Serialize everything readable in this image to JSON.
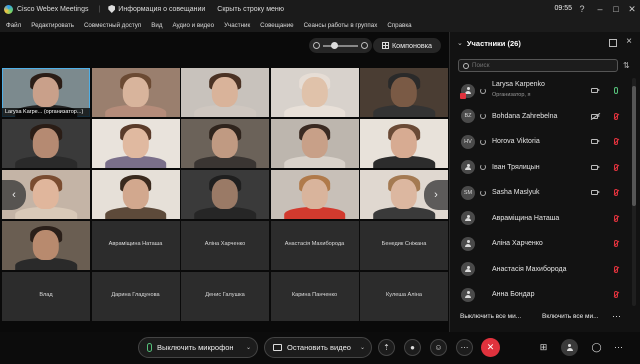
{
  "window": {
    "app_title": "Cisco Webex Meetings",
    "info_button": "Информация о совещании",
    "hide_menu_button": "Скрыть строку меню",
    "clock": "09:55"
  },
  "menu": [
    "Файл",
    "Редактировать",
    "Совместный доступ",
    "Вид",
    "Аудио и видео",
    "Участник",
    "Совещание",
    "Сеансы работы в группах",
    "Справка"
  ],
  "stage": {
    "layout_button": "Компоновка",
    "tiles": [
      {
        "type": "video",
        "label": "Larysa Karpe... (организатор...)",
        "skin": "#c9a08a",
        "hair": "#2b1d16",
        "shirt": "#222222",
        "bg": "#7c8a8e",
        "active": true
      },
      {
        "type": "video",
        "label": "",
        "skin": "#d8b49c",
        "hair": "#6b4a33",
        "shirt": "#b58c7a",
        "bg": "#9a7f6e"
      },
      {
        "type": "video",
        "label": "",
        "skin": "#d9b39a",
        "hair": "#4a3224",
        "shirt": "#cfc7c0",
        "bg": "#c8c2bc"
      },
      {
        "type": "video",
        "label": "",
        "skin": "#e0c2aa",
        "hair": "#e6ddd5",
        "shirt": "#e8e0d8",
        "bg": "#d8d2cc"
      },
      {
        "type": "video",
        "label": "",
        "skin": "#7a5a45",
        "hair": "#2a2a2a",
        "shirt": "#333333",
        "bg": "#4a3d33"
      },
      {
        "type": "video",
        "label": "",
        "skin": "#b58a72",
        "hair": "#2a1d16",
        "shirt": "#2a2a2a",
        "bg": "#3a3a3a"
      },
      {
        "type": "video",
        "label": "",
        "skin": "#e0b9a0",
        "hair": "#5a3b2a",
        "shirt": "#7a6f8a",
        "bg": "#e9e3dc"
      },
      {
        "type": "video",
        "label": "",
        "skin": "#c09a82",
        "hair": "#2f241d",
        "shirt": "#3a3532",
        "bg": "#6b6259"
      },
      {
        "type": "video",
        "label": "",
        "skin": "#c8a088",
        "hair": "#3a2a22",
        "shirt": "#d9d2ca",
        "bg": "#bdb6ae"
      },
      {
        "type": "video",
        "label": "",
        "skin": "#d7ab92",
        "hair": "#6a4a36",
        "shirt": "#2c2c2c",
        "bg": "#e8e2da"
      },
      {
        "type": "video",
        "label": "",
        "skin": "#e0b69c",
        "hair": "#7a4c30",
        "shirt": "#d9c9b8",
        "bg": "#c4b4a6"
      },
      {
        "type": "video",
        "label": "",
        "skin": "#d2a88e",
        "hair": "#3a2a1e",
        "shirt": "#5d4a3a",
        "bg": "#e6e0d8"
      },
      {
        "type": "video",
        "label": "",
        "skin": "#9a7a66",
        "hair": "#1f1f1f",
        "shirt": "#262626",
        "bg": "#3a3a3a"
      },
      {
        "type": "video",
        "label": "",
        "skin": "#d9b49c",
        "hair": "#b07a4a",
        "shirt": "#d23a2e",
        "bg": "#c8c0b8"
      },
      {
        "type": "video",
        "label": "",
        "skin": "#dcb7a0",
        "hair": "#a47a52",
        "shirt": "#3a3a3a",
        "bg": "#e0d8d0"
      },
      {
        "type": "video",
        "label": "",
        "skin": "#b88a6e",
        "hair": "#2a1f19",
        "shirt": "#2a2a2a",
        "bg": "#6a5e52"
      },
      {
        "type": "empty",
        "label": "Авраміщина Наташа"
      },
      {
        "type": "empty",
        "label": "Аліна Харченко"
      },
      {
        "type": "empty",
        "label": "Анастасія Махиборода"
      },
      {
        "type": "empty",
        "label": "Бенедик Сніжана"
      },
      {
        "type": "empty",
        "label": "Влад"
      },
      {
        "type": "empty",
        "label": "Дарина Гладунова"
      },
      {
        "type": "empty",
        "label": "Денис Галушка"
      },
      {
        "type": "empty",
        "label": "Карина Панченко"
      },
      {
        "type": "empty",
        "label": "Кулеша Аліна"
      }
    ]
  },
  "panel": {
    "title": "Участники (26)",
    "search_placeholder": "Поиск",
    "participants": [
      {
        "initials": "",
        "name": "Larysa Karpenko",
        "role": "Организатор, я",
        "video": "on",
        "mic": "on",
        "recording": true
      },
      {
        "initials": "BZ",
        "name": "Bohdana Zahrebelna",
        "role": "",
        "video": "off",
        "mic": "muted"
      },
      {
        "initials": "HV",
        "name": "Horova Viktoria",
        "role": "",
        "video": "on",
        "mic": "muted"
      },
      {
        "initials": "",
        "name": "Іван Трялицын",
        "role": "",
        "video": "on",
        "mic": "muted"
      },
      {
        "initials": "SM",
        "name": "Sasha Maslyuk",
        "role": "",
        "video": "on",
        "mic": "muted"
      },
      {
        "initials": "",
        "name": "Авраміщина Наташа",
        "role": "",
        "video": "",
        "mic": "muted"
      },
      {
        "initials": "",
        "name": "Аліна Харченко",
        "role": "",
        "video": "",
        "mic": "muted"
      },
      {
        "initials": "",
        "name": "Анастасія Махиборода",
        "role": "",
        "video": "",
        "mic": "muted"
      },
      {
        "initials": "",
        "name": "Анна Бондар",
        "role": "",
        "video": "",
        "mic": "muted"
      }
    ],
    "mute_all": "Выключить все ми...",
    "unmute_all": "Включить все ми..."
  },
  "controls": {
    "mute_button": "Выключить микрофон",
    "stop_video_button": "Остановить видео"
  },
  "colors": {
    "accent_blue": "#4fb0e8",
    "end_red": "#e0323d",
    "mic_green": "#56c17a"
  }
}
